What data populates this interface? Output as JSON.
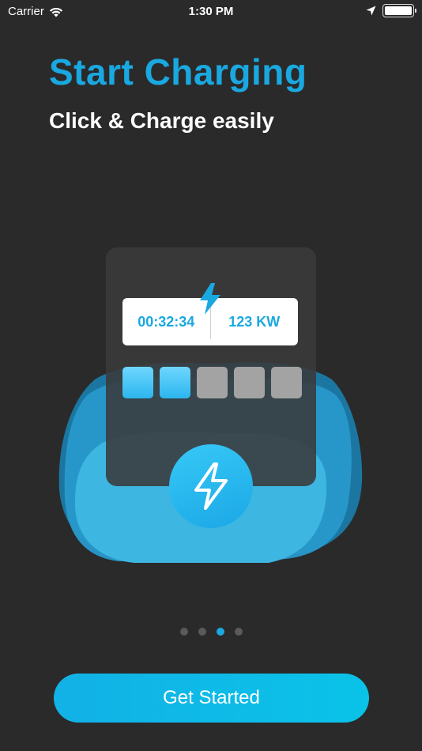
{
  "status_bar": {
    "carrier": "Carrier",
    "time": "1:30 PM"
  },
  "onboarding": {
    "title": "Start Charging",
    "subtitle": "Click & Charge easily",
    "readout": {
      "timer": "00:32:34",
      "power": "123 KW"
    },
    "battery_cells": {
      "filled": 2,
      "total": 5
    },
    "page_indicator": {
      "total": 4,
      "active": 3
    },
    "cta_label": "Get Started"
  },
  "icons": [
    "wifi-icon",
    "location-arrow-icon",
    "battery-icon",
    "lightning-bolt-icon"
  ],
  "colors": {
    "background": "#2a2a2a",
    "accent": "#1aa8e0",
    "card": "#3a3a3a",
    "inactive_dot": "#5a5a5a"
  }
}
